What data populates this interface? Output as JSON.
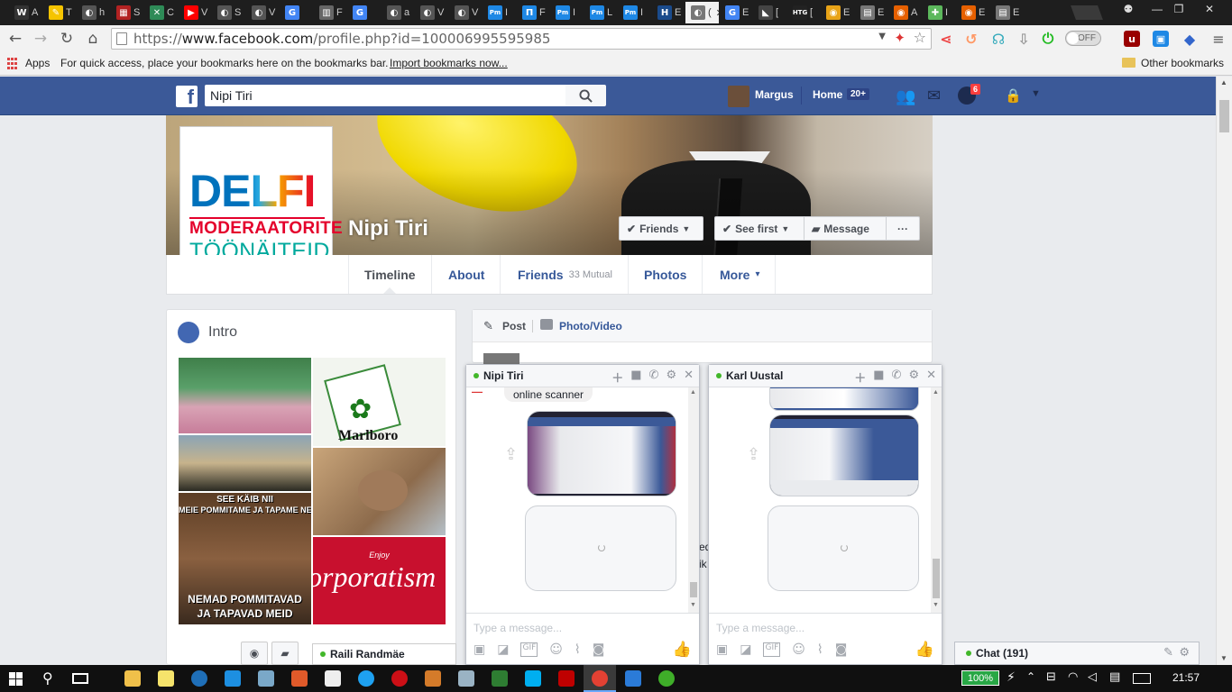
{
  "browser": {
    "tabs": [
      {
        "label": "A",
        "icon": "W",
        "color": "#333333"
      },
      {
        "label": "T",
        "icon": "✎",
        "color": "#f5c400"
      },
      {
        "label": "h",
        "icon": "◐",
        "color": "#555555"
      },
      {
        "label": "S",
        "icon": "▦",
        "color": "#b22222"
      },
      {
        "label": "C",
        "icon": "✕",
        "color": "#2e8b57"
      },
      {
        "label": "V",
        "icon": "▶",
        "color": "#ff0000"
      },
      {
        "label": "S",
        "icon": "◐",
        "color": "#555555"
      },
      {
        "label": "V",
        "icon": "◐",
        "color": "#555555"
      },
      {
        "label": "",
        "icon": "G",
        "color": "#4285f4"
      },
      {
        "label": "F",
        "icon": "▥",
        "color": "#666666"
      },
      {
        "label": "",
        "icon": "G",
        "color": "#4285f4"
      },
      {
        "label": "a",
        "icon": "◐",
        "color": "#555555"
      },
      {
        "label": "V",
        "icon": "◐",
        "color": "#555555"
      },
      {
        "label": "V",
        "icon": "◐",
        "color": "#555555"
      },
      {
        "label": "I",
        "icon": "Pm",
        "color": "#1e88e5"
      },
      {
        "label": "F",
        "icon": "Π",
        "color": "#1e88e5"
      },
      {
        "label": "I",
        "icon": "Pm",
        "color": "#1e88e5"
      },
      {
        "label": "L",
        "icon": "Pm",
        "color": "#1e88e5"
      },
      {
        "label": "I",
        "icon": "Pm",
        "color": "#1e88e5"
      },
      {
        "label": "E",
        "icon": "H",
        "color": "#1a4b8c"
      },
      {
        "label": "(",
        "icon": "◐",
        "color": "#777777",
        "active": true
      },
      {
        "label": "E",
        "icon": "G",
        "color": "#4285f4"
      },
      {
        "label": "[",
        "icon": "◣",
        "color": "#444444"
      },
      {
        "label": "[",
        "icon": "HTG",
        "color": "#222222"
      },
      {
        "label": "E",
        "icon": "◉",
        "color": "#e8a317"
      },
      {
        "label": "E",
        "icon": "▤",
        "color": "#777777"
      },
      {
        "label": "A",
        "icon": "◉",
        "color": "#e66000"
      },
      {
        "label": "I",
        "icon": "✚",
        "color": "#5cb85c"
      },
      {
        "label": "E",
        "icon": "◉",
        "color": "#e66000"
      },
      {
        "label": "E",
        "icon": "▤",
        "color": "#777777"
      }
    ],
    "url_scheme": "https://",
    "url_domain": "www.facebook.com",
    "url_path": "/profile.php?id=100006995595985",
    "toggle_label": "OFF",
    "bookmarks": {
      "apps": "Apps",
      "hint": "For quick access, place your bookmarks here on the bookmarks bar.",
      "import_link": "Import bookmarks now...",
      "other": "Other bookmarks"
    }
  },
  "facebook": {
    "search_value": "Nipi Tiri",
    "user_name": "Margus",
    "home_label": "Home",
    "home_badge": "20+",
    "notif_badge": "6",
    "profile_name": "Nipi Tiri",
    "profile_logo": {
      "brand": "DELFI",
      "line1": "MODERAATORITE",
      "line2": "TÖÖNÄITEID"
    },
    "buttons": {
      "friends": "Friends",
      "see_first": "See first",
      "message": "Message",
      "more_dots": "···"
    },
    "timeline_nav": [
      {
        "label": "Timeline",
        "sub": ""
      },
      {
        "label": "About",
        "sub": ""
      },
      {
        "label": "Friends",
        "sub": "33 Mutual"
      },
      {
        "label": "Photos",
        "sub": ""
      },
      {
        "label": "More",
        "sub": "▾"
      }
    ],
    "intro_title": "Intro",
    "composer": {
      "post": "Post",
      "photo_video": "Photo/Video"
    },
    "photos": [
      {
        "caption": ""
      },
      {
        "caption": "Marlboro"
      },
      {
        "caption": ""
      },
      {
        "caption": ""
      },
      {
        "top": "SEE KÄIB NII",
        "mid": "MEIE POMMITAME JA TAPAME NEID",
        "bottom": "NEMAD POMMITAVAD JA TAPAVAD MEID"
      },
      {
        "caption": "orporatism",
        "small": "Enjoy"
      }
    ],
    "chats": [
      {
        "name": "Nipi Tiri",
        "snippet": "online scanner",
        "input_placeholder": "Type a message..."
      },
      {
        "name": "Karl Uustal",
        "snippet": "",
        "input_placeholder": "Type a message..."
      }
    ],
    "peek_text": [
      "ed",
      "ik"
    ],
    "online_contact": "Raili Randmäe",
    "chat_bar": "Chat (191)"
  },
  "taskbar": {
    "battery": "100%",
    "clock": "21:57"
  }
}
